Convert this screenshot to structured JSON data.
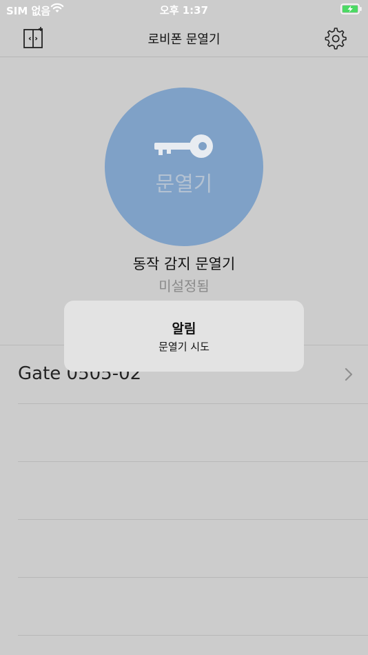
{
  "status_bar": {
    "carrier": "SIM 없음",
    "time": "오후 1:37"
  },
  "nav": {
    "title": "로비폰 문열기",
    "left_icon": "door-icon",
    "right_icon": "gear-icon"
  },
  "door_button": {
    "label": "문열기",
    "icon": "key-icon",
    "color": "#7fa1c7"
  },
  "motion": {
    "title": "동작 감지 문열기",
    "status": "미설정됨"
  },
  "gates": [
    {
      "name": "Gate 0505-02"
    },
    {
      "name": ""
    },
    {
      "name": ""
    },
    {
      "name": ""
    },
    {
      "name": ""
    }
  ],
  "alert": {
    "title": "알림",
    "message": "문열기 시도"
  }
}
